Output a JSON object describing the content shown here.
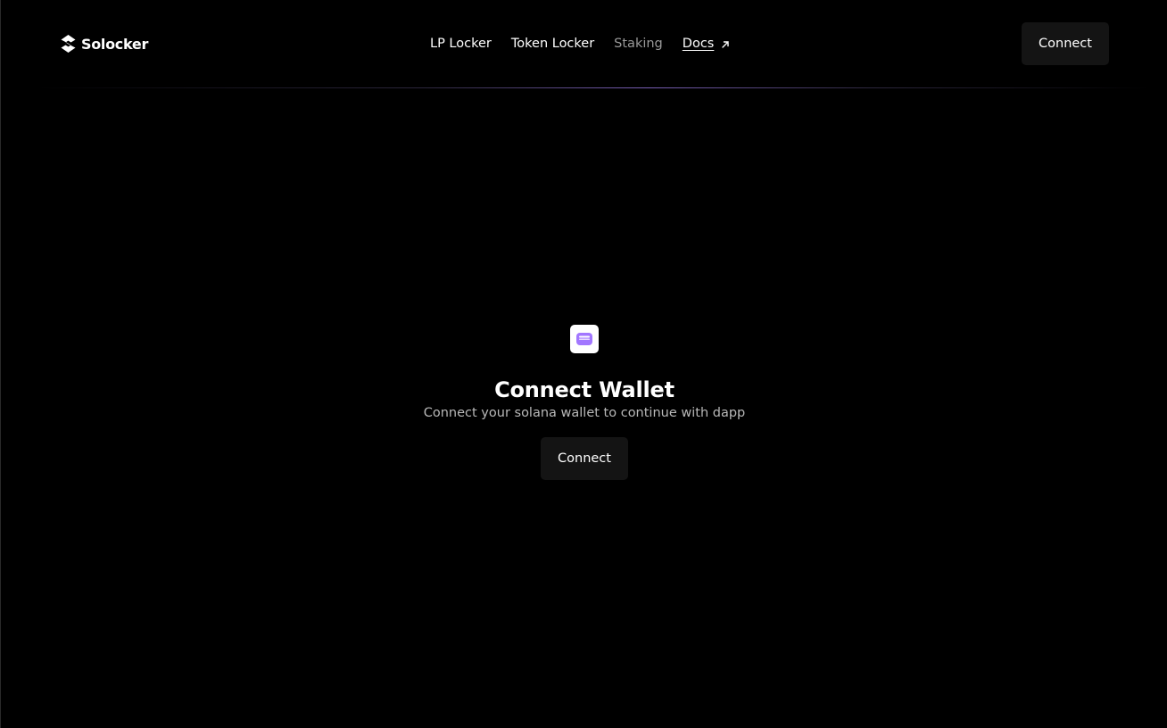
{
  "app": {
    "brand": "Solocker",
    "logo_icon": "solocker-logo-icon"
  },
  "nav": {
    "items": [
      {
        "label": "LP Locker",
        "state": "normal"
      },
      {
        "label": "Token Locker",
        "state": "normal"
      },
      {
        "label": "Staking",
        "state": "dimmed"
      },
      {
        "label": "Docs",
        "state": "external-link",
        "icon": "arrow-up-right-icon"
      }
    ]
  },
  "header": {
    "connect_label": "Connect"
  },
  "main": {
    "icon": "wallet-icon",
    "title": "Connect Wallet",
    "subtitle": "Connect your solana wallet to continue with dapp",
    "connect_label": "Connect"
  },
  "colors": {
    "background": "#000000",
    "button": "#141414",
    "accent": "#a277ff",
    "muted_text": "#9a9a9a"
  }
}
